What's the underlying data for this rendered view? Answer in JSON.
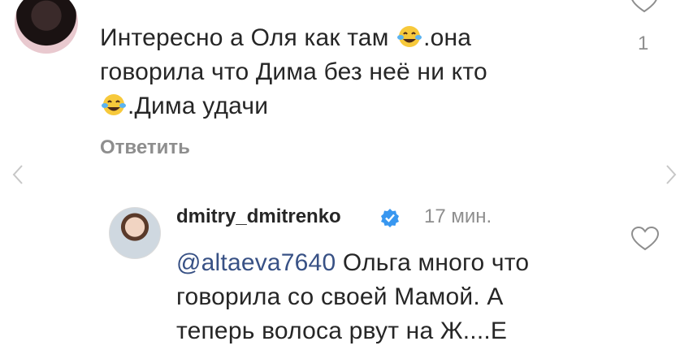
{
  "comment": {
    "line1_before": "Интересно а Оля как там ",
    "line1_after": ".она",
    "line2": "говорила что Дима без неё ни кто",
    "line3_after": ".Дима удачи",
    "reply_label": "Ответить",
    "like_count": "1",
    "emoji": "joy-emoji"
  },
  "reply": {
    "username": "dmitry_dmitrenko",
    "timestamp": "17 мин.",
    "mention": "@altaeva7640",
    "text_line1": " Ольга много что",
    "text_line2": "говорила со своей Мамой. А",
    "text_line3": "теперь волоса рвут на Ж....Е"
  },
  "colors": {
    "text": "#262626",
    "muted": "#8e8e8e",
    "mention": "#385185",
    "verified": "#3897f0"
  }
}
